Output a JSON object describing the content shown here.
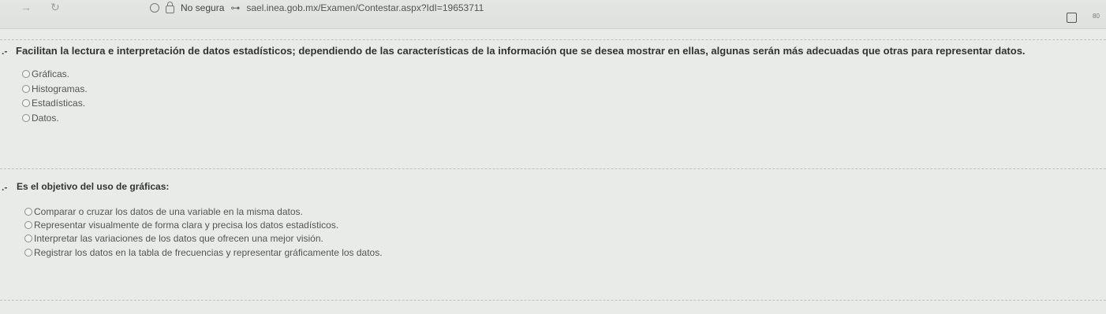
{
  "browser": {
    "security_label": "No segura",
    "url": "sael.inea.gob.mx/Examen/Contestar.aspx?IdI=19653711",
    "zoom": "80"
  },
  "questions": [
    {
      "number": ".-",
      "text": "Facilitan la lectura e interpretación de datos estadísticos; dependiendo de las características de la información que se desea mostrar en ellas, algunas serán más adecuadas que otras para representar datos.",
      "options": [
        "Gráficas.",
        "Histogramas.",
        "Estadísticas.",
        "Datos."
      ]
    },
    {
      "number": ".-",
      "text": "Es el objetivo del uso de gráficas:",
      "options": [
        "Comparar o cruzar los datos de una variable en la misma datos.",
        "Representar visualmente de forma clara y precisa los datos estadísticos.",
        "Interpretar las variaciones de los datos que ofrecen una mejor visión.",
        "Registrar los datos en la tabla de frecuencias y representar gráficamente los datos."
      ]
    }
  ]
}
